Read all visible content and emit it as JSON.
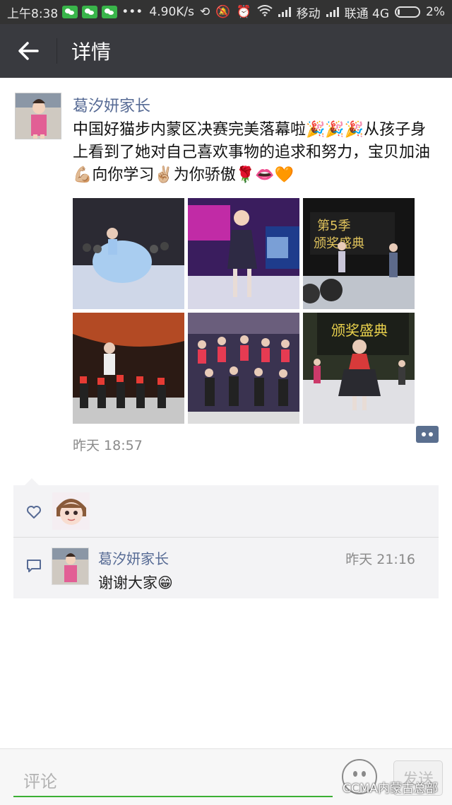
{
  "status_bar": {
    "time": "上午8:38",
    "net_speed": "4.90K/s",
    "carrier1": "移动",
    "carrier2": "联通 4G",
    "battery": "2%"
  },
  "header": {
    "back_icon": "arrow-left-icon",
    "title": "详情"
  },
  "post": {
    "author": "葛汐妍家长",
    "text": "中国好猫步内蒙区决赛完美落幕啦🎉🎉🎉从孩子身上看到了她对自己喜欢事物的追求和努力，宝贝加油💪🏼向你学习✌🏼为你骄傲🌹👄🧡",
    "photos": [
      {
        "bg1": "#2b2a33",
        "bg2": "#6f8fc4",
        "accent": "#bfe0ff"
      },
      {
        "bg1": "#4e2a74",
        "bg2": "#c02aa8",
        "accent": "#ffffff"
      },
      {
        "bg1": "#141414",
        "bg2": "#5b5b5b",
        "accent": "#e0c35c"
      },
      {
        "bg1": "#b34a24",
        "bg2": "#2b1a14",
        "accent": "#ff4d3a"
      },
      {
        "bg1": "#3a3350",
        "bg2": "#8e6e6e",
        "accent": "#e63b52"
      },
      {
        "bg1": "#2d3326",
        "bg2": "#bfb68a",
        "accent": "#ccd46b"
      }
    ],
    "photo_text_3": "第5季 颁奖盛典",
    "photo_text_6": "颁奖盛典",
    "time": "昨天 18:57"
  },
  "interactions": {
    "like_icon": "heart-icon",
    "comment_icon": "comment-icon",
    "comments": [
      {
        "name": "葛汐妍家长",
        "time": "昨天 21:16",
        "text": "谢谢大家😁"
      }
    ]
  },
  "bottom_bar": {
    "placeholder": "评论",
    "send_label": "发送",
    "watermark": "CCMA内蒙古总部"
  },
  "colors": {
    "link": "#576b95",
    "header_bg": "#393a3f",
    "accent_green": "#3cb034"
  }
}
